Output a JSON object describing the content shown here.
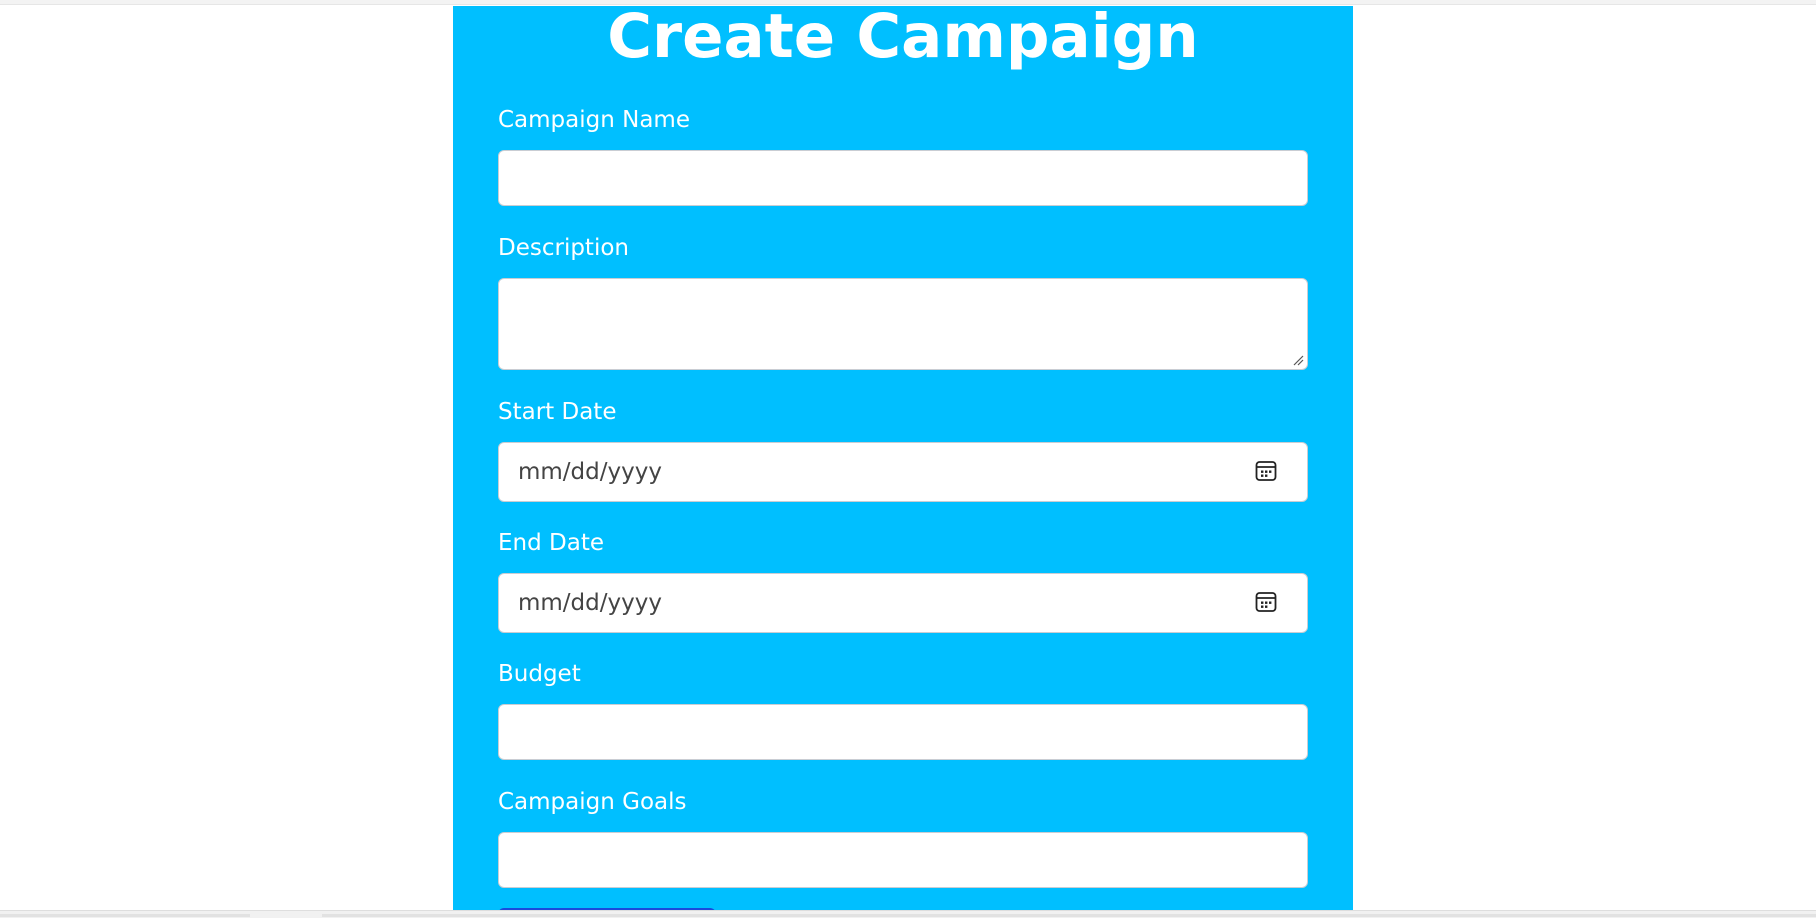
{
  "page": {
    "title": "Create Campaign"
  },
  "form": {
    "campaign_name": {
      "label": "Campaign Name",
      "value": ""
    },
    "description": {
      "label": "Description",
      "value": ""
    },
    "start_date": {
      "label": "Start Date",
      "placeholder": "mm/dd/yyyy",
      "icon": "calendar-icon"
    },
    "end_date": {
      "label": "End Date",
      "placeholder": "mm/dd/yyyy",
      "icon": "calendar-icon"
    },
    "budget": {
      "label": "Budget",
      "value": ""
    },
    "campaign_goals": {
      "label": "Campaign Goals",
      "value": ""
    }
  },
  "colors": {
    "panel_background": "#00bfff",
    "text_on_panel": "#ffffff",
    "submit_button": "#1a4bdc"
  }
}
